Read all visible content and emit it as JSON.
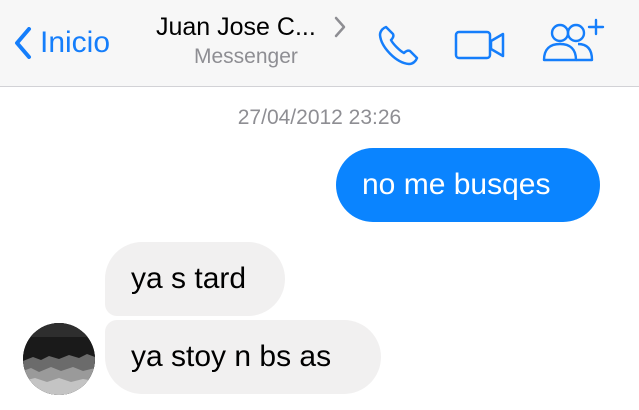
{
  "navbar": {
    "back_label": "Inicio",
    "contact_name": "Juan Jose C...",
    "subtitle": "Messenger",
    "icons": {
      "back": "chevron-left-icon",
      "details": "chevron-right-icon",
      "call": "phone-icon",
      "video": "video-camera-icon",
      "add_people": "add-group-icon"
    }
  },
  "thread": {
    "timestamp": "27/04/2012 23:26",
    "messages": [
      {
        "direction": "outgoing",
        "text": "no me busqes"
      },
      {
        "direction": "incoming",
        "text": "ya s tard"
      },
      {
        "direction": "incoming",
        "text": "ya stoy n bs as"
      }
    ]
  },
  "colors": {
    "accent": "#157efb",
    "outgoing_bubble": "#0a84ff",
    "incoming_bubble": "#f1f0f0",
    "secondary_text": "#8e8e93"
  }
}
